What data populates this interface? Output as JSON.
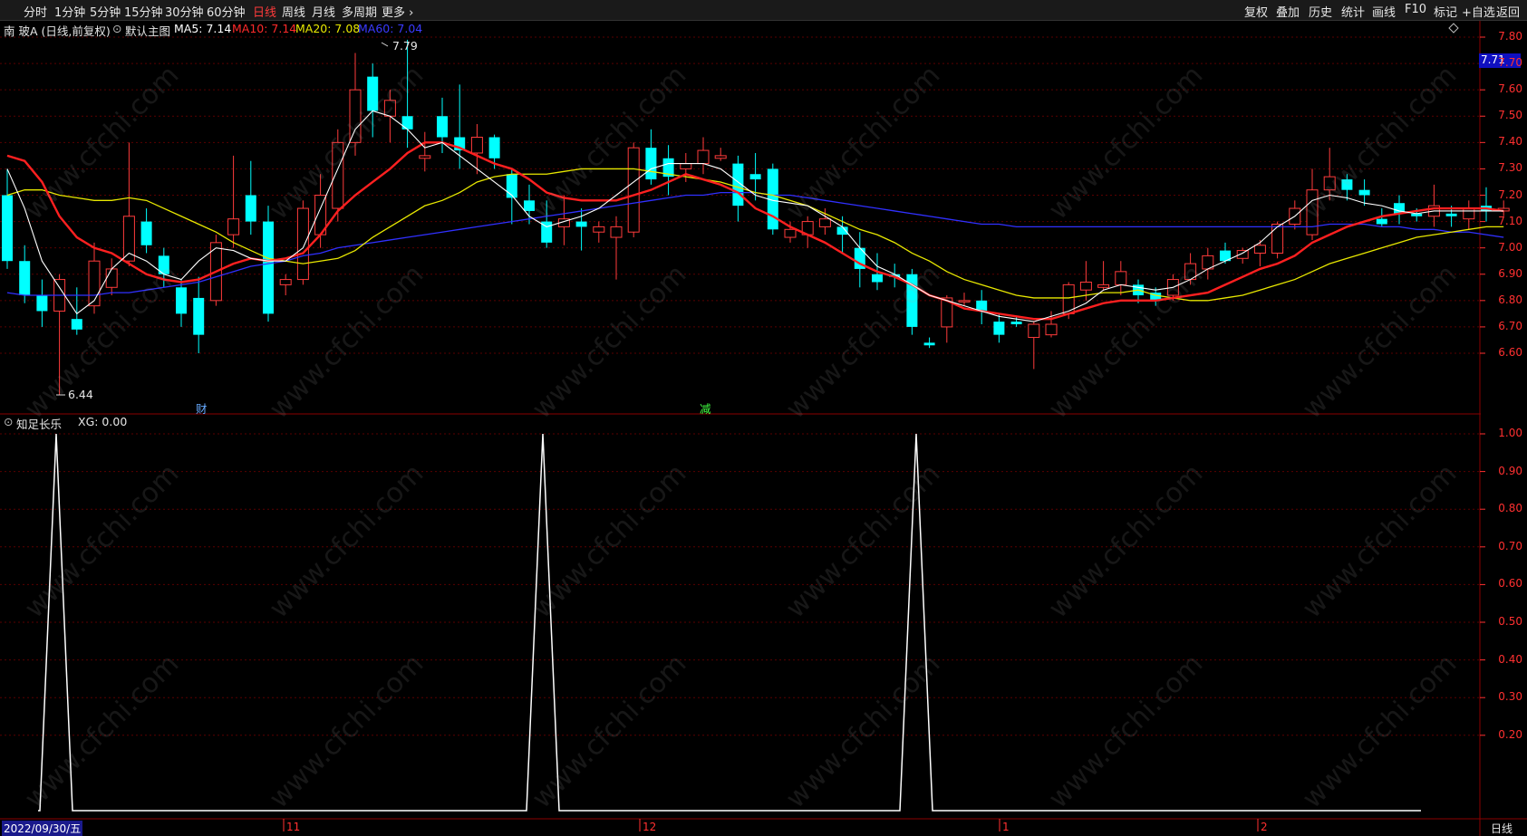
{
  "toolbar": {
    "left": [
      "分时",
      "1分钟",
      "5分钟",
      "15分钟",
      "30分钟",
      "60分钟",
      "日线",
      "周线",
      "月线",
      "多周期",
      "更多 ›"
    ],
    "active": "日线",
    "right": [
      "复权",
      "叠加",
      "历史",
      "统计",
      "画线",
      "F10",
      "标记",
      "+自选",
      "返回"
    ]
  },
  "main_header": {
    "stock": "南 玻A (日线,前复权)",
    "template": "默认主图",
    "ma5": "MA5: 7.14",
    "ma10": "MA10: 7.14",
    "ma20": "MA20: 7.08",
    "ma60": "MA60: 7.04"
  },
  "colors": {
    "up": "#ff3b3b",
    "down": "#00ffff",
    "ma5": "#ffffff",
    "ma10": "#ff2020",
    "ma20": "#e8e800",
    "ma60": "#3030ff",
    "grid": "#5a0000",
    "axis": "#ff3030"
  },
  "price_axis": [
    "7.80",
    "7.71",
    "7.70",
    "7.60",
    "7.50",
    "7.40",
    "7.30",
    "7.20",
    "7.10",
    "7.00",
    "6.90",
    "6.80",
    "6.70",
    "6.60"
  ],
  "current_price": "7.71",
  "annotations": {
    "high": "7.79",
    "low": "6.44",
    "event1": "财",
    "event2": "减"
  },
  "indicator": {
    "name": "知足长乐",
    "value": "XG: 0.00",
    "axis": [
      "1.00",
      "0.90",
      "0.80",
      "0.70",
      "0.60",
      "0.50",
      "0.40",
      "0.30",
      "0.20"
    ]
  },
  "date_axis": {
    "start": "2022/09/30/五",
    "ticks": [
      "11",
      "12",
      "1",
      "2"
    ],
    "period_label": "日线"
  },
  "watermark": "www.cfchi.com",
  "chart_data": [
    {
      "type": "candlestick",
      "title": "南 玻A (日线,前复权)",
      "y_range": [
        6.44,
        7.79
      ],
      "candles_ohlc": [
        [
          7.2,
          7.3,
          6.92,
          6.95
        ],
        [
          6.95,
          7.01,
          6.79,
          6.82
        ],
        [
          6.82,
          6.88,
          6.7,
          6.76
        ],
        [
          6.76,
          6.9,
          6.44,
          6.88
        ],
        [
          6.73,
          6.85,
          6.67,
          6.69
        ],
        [
          6.78,
          7.02,
          6.75,
          6.95
        ],
        [
          6.85,
          6.96,
          6.82,
          6.92
        ],
        [
          6.95,
          7.4,
          6.93,
          7.12
        ],
        [
          7.1,
          7.15,
          6.98,
          7.01
        ],
        [
          6.97,
          7.0,
          6.85,
          6.9
        ],
        [
          6.85,
          6.88,
          6.7,
          6.75
        ],
        [
          6.81,
          6.89,
          6.6,
          6.67
        ],
        [
          6.8,
          7.05,
          6.78,
          7.02
        ],
        [
          7.05,
          7.35,
          7.0,
          7.11
        ],
        [
          7.2,
          7.33,
          7.05,
          7.1
        ],
        [
          7.1,
          7.16,
          6.72,
          6.75
        ],
        [
          6.86,
          6.9,
          6.82,
          6.88
        ],
        [
          6.88,
          7.18,
          6.86,
          7.15
        ],
        [
          7.05,
          7.28,
          7.0,
          7.2
        ],
        [
          7.15,
          7.45,
          7.1,
          7.4
        ],
        [
          7.4,
          7.74,
          7.35,
          7.6
        ],
        [
          7.65,
          7.7,
          7.42,
          7.52
        ],
        [
          7.5,
          7.6,
          7.4,
          7.56
        ],
        [
          7.5,
          7.79,
          7.38,
          7.45
        ],
        [
          7.34,
          7.44,
          7.29,
          7.35
        ],
        [
          7.5,
          7.57,
          7.36,
          7.42
        ],
        [
          7.42,
          7.62,
          7.3,
          7.37
        ],
        [
          7.36,
          7.47,
          7.28,
          7.42
        ],
        [
          7.42,
          7.43,
          7.3,
          7.34
        ],
        [
          7.28,
          7.3,
          7.09,
          7.19
        ],
        [
          7.18,
          7.24,
          7.09,
          7.14
        ],
        [
          7.1,
          7.18,
          7.0,
          7.02
        ],
        [
          7.08,
          7.2,
          7.01,
          7.11
        ],
        [
          7.1,
          7.15,
          6.99,
          7.08
        ],
        [
          7.06,
          7.1,
          7.02,
          7.08
        ],
        [
          7.04,
          7.12,
          6.88,
          7.08
        ],
        [
          7.06,
          7.4,
          7.04,
          7.38
        ],
        [
          7.38,
          7.45,
          7.24,
          7.26
        ],
        [
          7.34,
          7.39,
          7.2,
          7.27
        ],
        [
          7.3,
          7.36,
          7.25,
          7.32
        ],
        [
          7.32,
          7.42,
          7.28,
          7.37
        ],
        [
          7.34,
          7.38,
          7.33,
          7.35
        ],
        [
          7.32,
          7.35,
          7.1,
          7.16
        ],
        [
          7.28,
          7.36,
          7.18,
          7.26
        ],
        [
          7.3,
          7.32,
          7.05,
          7.07
        ],
        [
          7.04,
          7.1,
          7.02,
          7.07
        ],
        [
          7.05,
          7.12,
          7.0,
          7.1
        ],
        [
          7.08,
          7.15,
          7.05,
          7.11
        ],
        [
          7.08,
          7.12,
          6.98,
          7.05
        ],
        [
          7.0,
          7.06,
          6.85,
          6.92
        ],
        [
          6.9,
          6.98,
          6.84,
          6.87
        ],
        [
          6.9,
          6.94,
          6.85,
          6.89
        ],
        [
          6.9,
          6.92,
          6.67,
          6.7
        ],
        [
          6.64,
          6.66,
          6.62,
          6.63
        ],
        [
          6.7,
          6.82,
          6.64,
          6.81
        ],
        [
          6.8,
          6.83,
          6.78,
          6.8
        ],
        [
          6.8,
          6.84,
          6.71,
          6.76
        ],
        [
          6.72,
          6.75,
          6.64,
          6.67
        ],
        [
          6.72,
          6.74,
          6.7,
          6.71
        ],
        [
          6.66,
          6.72,
          6.54,
          6.71
        ],
        [
          6.67,
          6.76,
          6.66,
          6.71
        ],
        [
          6.75,
          6.87,
          6.73,
          6.86
        ],
        [
          6.84,
          6.95,
          6.8,
          6.87
        ],
        [
          6.85,
          6.95,
          6.84,
          6.86
        ],
        [
          6.86,
          6.95,
          6.82,
          6.91
        ],
        [
          6.86,
          6.88,
          6.79,
          6.82
        ],
        [
          6.83,
          6.85,
          6.78,
          6.8
        ],
        [
          6.82,
          6.9,
          6.8,
          6.88
        ],
        [
          6.88,
          6.98,
          6.86,
          6.94
        ],
        [
          6.92,
          7.0,
          6.88,
          6.97
        ],
        [
          6.99,
          7.02,
          6.94,
          6.95
        ],
        [
          6.96,
          7.0,
          6.94,
          6.99
        ],
        [
          6.98,
          7.03,
          6.93,
          7.01
        ],
        [
          6.98,
          7.1,
          6.96,
          7.09
        ],
        [
          7.09,
          7.18,
          7.07,
          7.15
        ],
        [
          7.05,
          7.3,
          7.03,
          7.22
        ],
        [
          7.22,
          7.38,
          7.18,
          7.27
        ],
        [
          7.26,
          7.28,
          7.18,
          7.22
        ],
        [
          7.22,
          7.26,
          7.16,
          7.2
        ],
        [
          7.11,
          7.15,
          7.08,
          7.09
        ],
        [
          7.17,
          7.2,
          7.09,
          7.13
        ],
        [
          7.13,
          7.15,
          7.1,
          7.12
        ],
        [
          7.12,
          7.24,
          7.08,
          7.16
        ],
        [
          7.13,
          7.16,
          7.08,
          7.12
        ],
        [
          7.11,
          7.18,
          7.07,
          7.15
        ],
        [
          7.16,
          7.23,
          7.1,
          7.14
        ],
        [
          7.14,
          7.18,
          7.12,
          7.15
        ]
      ],
      "ma5": [
        7.3,
        7.15,
        6.95,
        6.85,
        6.75,
        6.8,
        6.92,
        6.98,
        6.95,
        6.9,
        6.88,
        6.95,
        7.0,
        6.99,
        6.96,
        6.95,
        6.95,
        7.0,
        7.15,
        7.3,
        7.45,
        7.52,
        7.5,
        7.45,
        7.38,
        7.4,
        7.35,
        7.3,
        7.25,
        7.2,
        7.12,
        7.08,
        7.1,
        7.12,
        7.15,
        7.2,
        7.25,
        7.3,
        7.32,
        7.32,
        7.32,
        7.3,
        7.25,
        7.2,
        7.18,
        7.17,
        7.16,
        7.12,
        7.08,
        7.0,
        6.93,
        6.9,
        6.86,
        6.82,
        6.8,
        6.78,
        6.76,
        6.74,
        6.73,
        6.72,
        6.74,
        6.76,
        6.79,
        6.84,
        6.86,
        6.85,
        6.84,
        6.85,
        6.88,
        6.92,
        6.95,
        6.98,
        7.02,
        7.08,
        7.12,
        7.18,
        7.2,
        7.19,
        7.17,
        7.16,
        7.14,
        7.13,
        7.14,
        7.14,
        7.14,
        7.14,
        7.14
      ],
      "ma10": [
        7.35,
        7.33,
        7.25,
        7.12,
        7.04,
        7.0,
        6.98,
        6.94,
        6.9,
        6.88,
        6.87,
        6.88,
        6.91,
        6.94,
        6.96,
        6.95,
        6.96,
        6.98,
        7.05,
        7.14,
        7.2,
        7.25,
        7.3,
        7.36,
        7.4,
        7.4,
        7.38,
        7.35,
        7.32,
        7.3,
        7.26,
        7.21,
        7.19,
        7.18,
        7.18,
        7.18,
        7.2,
        7.22,
        7.25,
        7.28,
        7.26,
        7.24,
        7.21,
        7.15,
        7.12,
        7.08,
        7.05,
        7.02,
        6.98,
        6.94,
        6.91,
        6.89,
        6.86,
        6.82,
        6.8,
        6.77,
        6.76,
        6.75,
        6.74,
        6.73,
        6.73,
        6.75,
        6.77,
        6.79,
        6.8,
        6.8,
        6.8,
        6.81,
        6.82,
        6.83,
        6.86,
        6.89,
        6.92,
        6.94,
        6.97,
        7.02,
        7.05,
        7.08,
        7.1,
        7.12,
        7.13,
        7.14,
        7.15,
        7.15,
        7.15,
        7.15,
        7.14
      ],
      "ma20": [
        7.2,
        7.22,
        7.22,
        7.2,
        7.19,
        7.18,
        7.18,
        7.19,
        7.18,
        7.15,
        7.12,
        7.09,
        7.06,
        7.02,
        6.99,
        6.96,
        6.95,
        6.94,
        6.95,
        6.96,
        6.99,
        7.04,
        7.08,
        7.12,
        7.16,
        7.18,
        7.21,
        7.25,
        7.27,
        7.28,
        7.28,
        7.28,
        7.29,
        7.3,
        7.3,
        7.3,
        7.3,
        7.29,
        7.28,
        7.27,
        7.26,
        7.25,
        7.23,
        7.21,
        7.2,
        7.18,
        7.16,
        7.13,
        7.1,
        7.07,
        7.05,
        7.02,
        6.98,
        6.95,
        6.91,
        6.88,
        6.86,
        6.84,
        6.82,
        6.81,
        6.81,
        6.81,
        6.82,
        6.83,
        6.83,
        6.84,
        6.82,
        6.81,
        6.8,
        6.8,
        6.81,
        6.82,
        6.84,
        6.86,
        6.88,
        6.91,
        6.94,
        6.96,
        6.98,
        7.0,
        7.02,
        7.04,
        7.05,
        7.06,
        7.07,
        7.08,
        7.08
      ],
      "ma60": [
        6.83,
        6.82,
        6.82,
        6.82,
        6.82,
        6.82,
        6.83,
        6.83,
        6.84,
        6.85,
        6.86,
        6.87,
        6.89,
        6.91,
        6.93,
        6.94,
        6.95,
        6.97,
        6.98,
        7.0,
        7.01,
        7.02,
        7.03,
        7.04,
        7.05,
        7.06,
        7.07,
        7.08,
        7.09,
        7.1,
        7.11,
        7.12,
        7.13,
        7.14,
        7.15,
        7.16,
        7.17,
        7.18,
        7.19,
        7.2,
        7.2,
        7.21,
        7.21,
        7.21,
        7.2,
        7.2,
        7.19,
        7.18,
        7.17,
        7.16,
        7.15,
        7.14,
        7.13,
        7.12,
        7.11,
        7.1,
        7.09,
        7.09,
        7.08,
        7.08,
        7.08,
        7.08,
        7.08,
        7.08,
        7.08,
        7.08,
        7.08,
        7.08,
        7.08,
        7.08,
        7.08,
        7.08,
        7.08,
        7.08,
        7.08,
        7.08,
        7.09,
        7.09,
        7.09,
        7.08,
        7.08,
        7.07,
        7.07,
        7.06,
        7.06,
        7.05,
        7.04
      ]
    },
    {
      "type": "line",
      "title": "知足长乐",
      "series": [
        {
          "name": "XG",
          "spikes_at_index": [
            3,
            33,
            56
          ],
          "values_baseline": 0,
          "spike_value": 1
        }
      ],
      "ylim": [
        0,
        1
      ]
    }
  ]
}
